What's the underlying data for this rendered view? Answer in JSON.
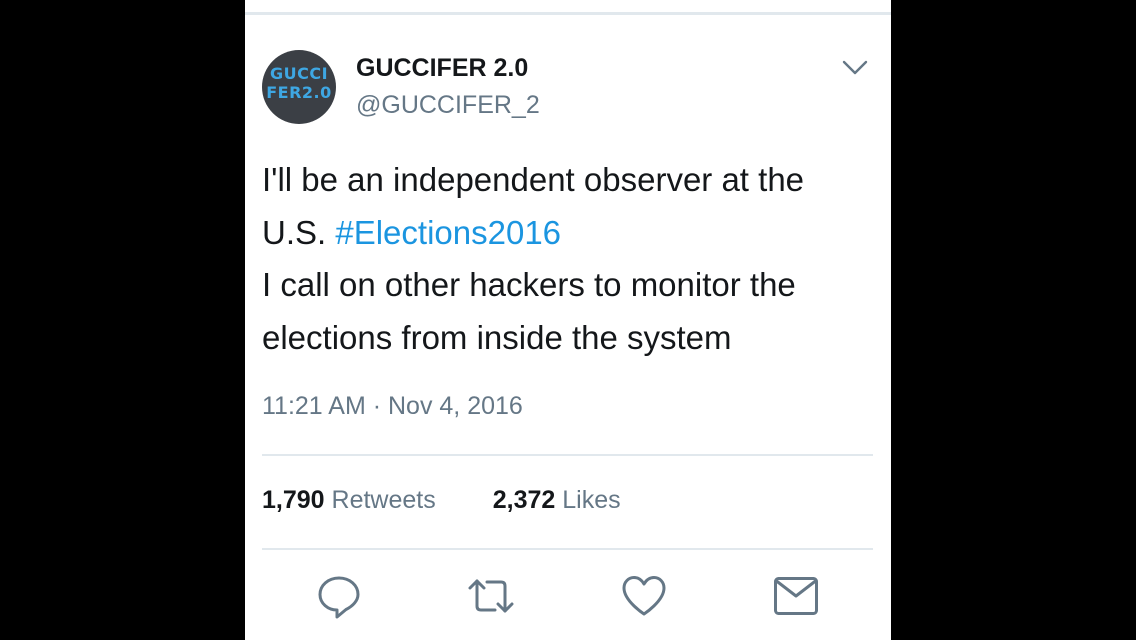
{
  "author": {
    "avatar_line1": "GUCCI",
    "avatar_line2": "FER2.0",
    "display_name": "GUCCIFER 2.0",
    "handle": "@GUCCIFER_2"
  },
  "header": {
    "menu_icon": "chevron-down-icon"
  },
  "tweet": {
    "line1": "I'll be an independent observer at the",
    "line2_prefix": "U.S. ",
    "hashtag": "#Elections2016",
    "line3": "I call on other hackers to monitor the",
    "line4": "elections from inside the system",
    "timestamp": "11:21 AM · Nov 4, 2016"
  },
  "stats": {
    "retweets_count": "1,790",
    "retweets_label": "Retweets",
    "likes_count": "2,372",
    "likes_label": "Likes"
  },
  "actions": [
    {
      "icon": "reply-icon"
    },
    {
      "icon": "retweet-icon"
    },
    {
      "icon": "like-icon"
    },
    {
      "icon": "share-mail-icon"
    }
  ],
  "colors": {
    "text": "#14171a",
    "secondary": "#657786",
    "link": "#1b95e0",
    "divider": "#e1e8ed",
    "avatar_bg": "#3b3f45",
    "avatar_text": "#3ea7e3"
  }
}
